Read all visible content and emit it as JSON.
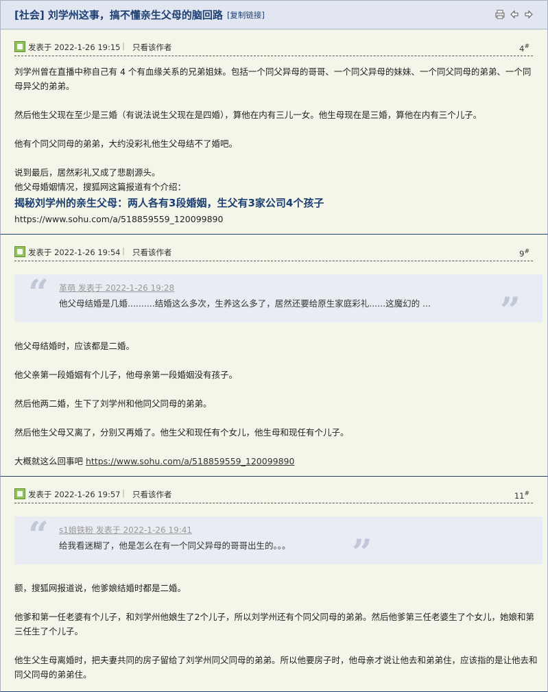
{
  "header": {
    "title": "[社会] 刘学州这事，搞不懂亲生父母的脑回路",
    "copy_link": "[复制链接]"
  },
  "posts": [
    {
      "time": "发表于 2022-1-26 19:15",
      "separator": "|",
      "only_author": "只看该作者",
      "floor": "4",
      "floor_mark": "#",
      "paragraphs": [
        "刘学州曾在直播中称自己有 4 个有血缘关系的兄弟姐妹。包括一个同父异母的哥哥、一个同父异母的妹妹、一个同父同母的弟弟、一个同母异父的弟弟。",
        "然后他生父现在至少是三婚（有说法说生父现在是四婚），算他在内有三儿一女。他生母现在是三婚，算他在内有三个儿子。",
        "他有个同父同母的弟弟，大约没彩礼他生父母结不了婚吧。",
        "说到最后，居然彩礼又成了悲剧源头。",
        "他父母婚姻情况，搜狐网这篇报道有个介绍："
      ],
      "headline": "揭秘刘学州的亲生父母：两人各有3段婚姻，生父有3家公司4个孩子",
      "url": "https://www.sohu.com/a/518859559_120099890"
    },
    {
      "time": "发表于 2022-1-26 19:54",
      "separator": "|",
      "only_author": "只看该作者",
      "floor": "9",
      "floor_mark": "#",
      "quote": {
        "author": "革萌 发表于 2022-1-26 19:28",
        "text": "他父母结婚是几婚..........结婚这么多次，生养这么多了，居然还要给原生家庭彩礼......这魔幻的 ..."
      },
      "paragraphs": [
        "他父母结婚时，应该都是二婚。",
        "他父亲第一段婚姻有个儿子，他母亲第一段婚姻没有孩子。",
        "然后他两二婚，生下了刘学州和他同父同母的弟弟。",
        "然后他生父母又离了，分别又再婚了。他生父和现任有个女儿，他生母和现任有个儿子。"
      ],
      "last_prefix": "大概就这么回事吧",
      "url": "https://www.sohu.com/a/518859559_120099890"
    },
    {
      "time": "发表于 2022-1-26 19:57",
      "separator": "|",
      "only_author": "只看该作者",
      "floor": "11",
      "floor_mark": "#",
      "quote": {
        "author": "s1娘铁粉 发表于 2022-1-26 19:41",
        "text": "给我看迷糊了，他是怎么在有一个同父异母的哥哥出生的。。。"
      },
      "paragraphs": [
        "额，搜狐网报道说，他爹娘结婚时都是二婚。",
        "他爹和第一任老婆有个儿子，和刘学州他娘生了2个儿子，所以刘学州还有个同父同母的弟弟。然后他爹第三任老婆生了个女儿，她娘和第三任生了个儿子。",
        "他生父生母离婚时，把夫妻共同的房子留给了刘学州同父同母的弟弟。所以他要房子时，他母亲才说让他去和弟弟住，应该指的是让他去和同父同母的弟弟住。"
      ]
    }
  ],
  "icons": [
    "print-icon",
    "prev-thread-icon",
    "next-thread-icon",
    "avatar-icon"
  ],
  "colors": {
    "accent": "#1d3f73",
    "background": "#f3f6e9",
    "quote_bg": "#e9ecf2"
  }
}
